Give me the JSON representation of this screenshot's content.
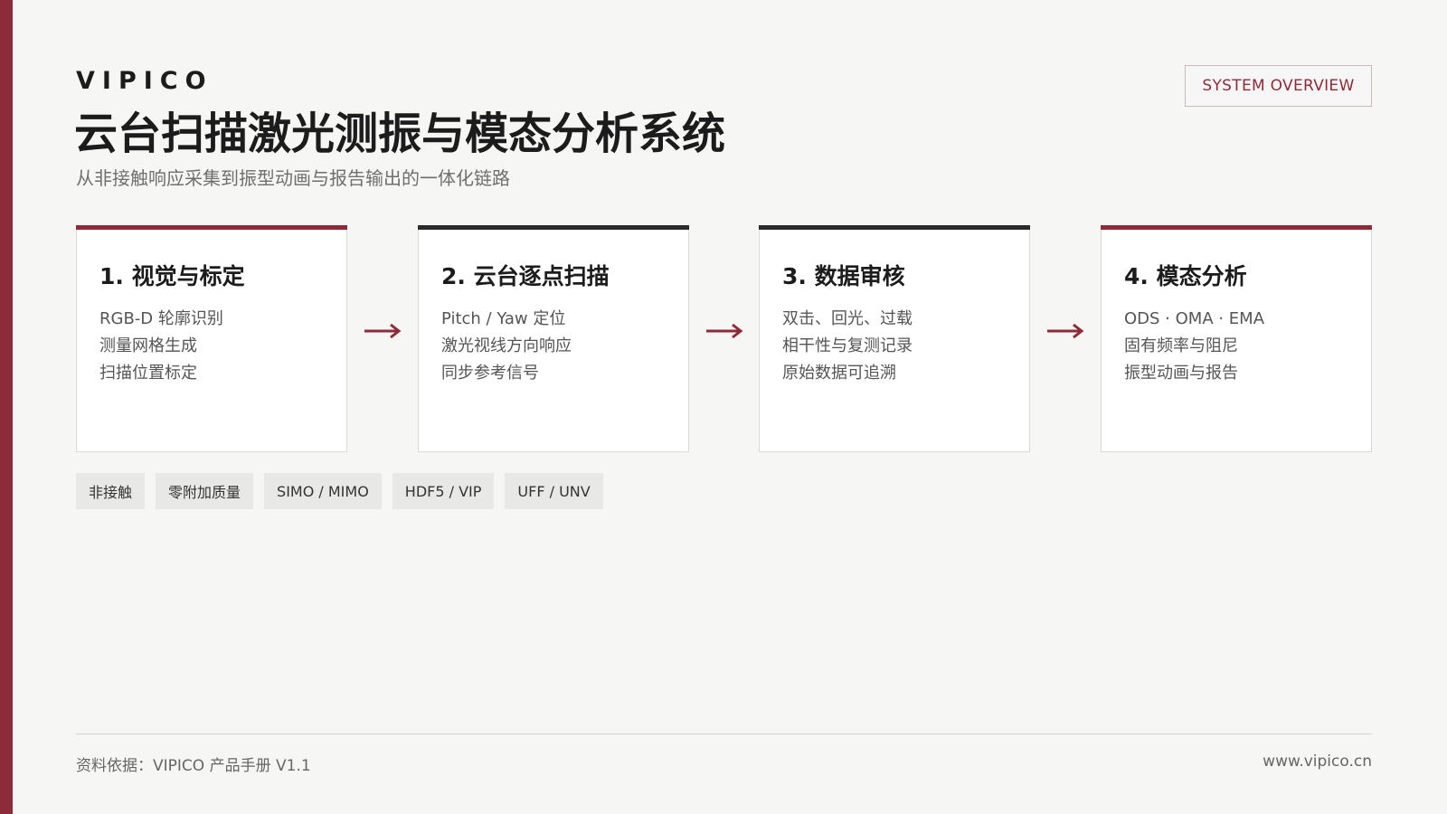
{
  "brand": "VIPICO",
  "title": "云台扫描激光测振与模态分析系统",
  "subtitle": "从非接触响应采集到振型动画与报告输出的一体化链路",
  "overview_button": "SYSTEM OVERVIEW",
  "accent_color": "#8e2b39",
  "steps": [
    {
      "title": "1. 视觉与标定",
      "lines": [
        "RGB-D 轮廓识别",
        "测量网格生成",
        "扫描位置标定"
      ]
    },
    {
      "title": "2. 云台逐点扫描",
      "lines": [
        "Pitch / Yaw 定位",
        "激光视线方向响应",
        "同步参考信号"
      ]
    },
    {
      "title": "3. 数据审核",
      "lines": [
        "双击、回光、过载",
        "相干性与复测记录",
        "原始数据可追溯"
      ]
    },
    {
      "title": "4. 模态分析",
      "lines": [
        "ODS · OMA · EMA",
        "固有频率与阻尼",
        "振型动画与报告"
      ]
    }
  ],
  "arrow_icon": "right-arrow-icon",
  "tags": [
    "非接触",
    "零附加质量",
    "SIMO / MIMO",
    "HDF5 / VIP",
    "UFF / UNV"
  ],
  "footer": {
    "source": "资料依据：VIPICO 产品手册 V1.1",
    "website": "www.vipico.cn"
  }
}
